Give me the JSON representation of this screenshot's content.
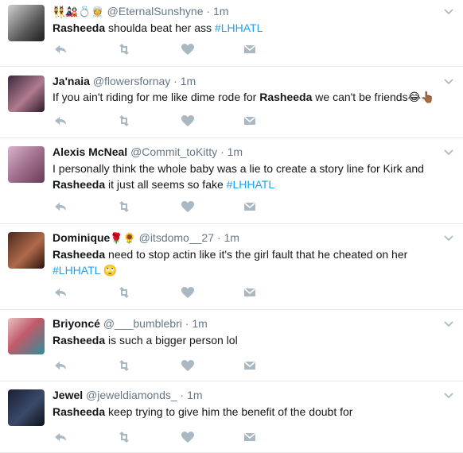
{
  "timeline": {
    "tweets": [
      {
        "name": "",
        "badges": "👯🎎💍👳",
        "handle": "@EternalSunshyne",
        "dot": "·",
        "time": "1m",
        "segments": [
          {
            "t": "Rasheeda",
            "k": "bold"
          },
          {
            "t": " shoulda beat her ass  ",
            "k": "plain"
          },
          {
            "t": "#LHHATL",
            "k": "tag"
          }
        ]
      },
      {
        "name": "Ja'naia",
        "badges": "",
        "handle": "@flowersfornay",
        "dot": "·",
        "time": "1m",
        "segments": [
          {
            "t": "If you ain't riding for me like dime rode for ",
            "k": "plain"
          },
          {
            "t": "Rasheeda",
            "k": "bold"
          },
          {
            "t": " we can't be friends",
            "k": "plain"
          },
          {
            "t": "😂👆🏾",
            "k": "plain"
          }
        ]
      },
      {
        "name": "Alexis McNeal",
        "badges": "",
        "handle": "@Commit_toKitty",
        "dot": "·",
        "time": "1m",
        "segments": [
          {
            "t": "I personally think the whole baby was a lie to create a story line for Kirk and ",
            "k": "plain"
          },
          {
            "t": "Rasheeda",
            "k": "bold"
          },
          {
            "t": " it just all seems so fake ",
            "k": "plain"
          },
          {
            "t": "#LHHATL",
            "k": "tag"
          }
        ]
      },
      {
        "name": "Dominique",
        "badges": "🌹🌻",
        "handle": "@itsdomo__27",
        "dot": "·",
        "time": "1m",
        "segments": [
          {
            "t": "Rasheeda",
            "k": "bold"
          },
          {
            "t": " need to stop actin like it's the girl fault that he cheated on her ",
            "k": "plain"
          },
          {
            "t": "#LHHATL",
            "k": "tag"
          },
          {
            "t": " 🙄",
            "k": "plain"
          }
        ]
      },
      {
        "name": "Briyoncé",
        "badges": "",
        "handle": "@___bumblebri",
        "dot": "·",
        "time": "1m",
        "segments": [
          {
            "t": "Rasheeda",
            "k": "bold"
          },
          {
            "t": " is such a bigger person lol",
            "k": "plain"
          }
        ]
      },
      {
        "name": "Jewel",
        "badges": "",
        "handle": "@jeweldiamonds_",
        "dot": "·",
        "time": "1m",
        "segments": [
          {
            "t": "Rasheeda",
            "k": "bold"
          },
          {
            "t": " keep trying to give him the benefit of the doubt for",
            "k": "plain"
          }
        ]
      }
    ]
  },
  "colors": {
    "text": "#14171a",
    "muted": "#657786",
    "hashtag": "#1da1f2",
    "action_icon": "#aab8c2",
    "divider": "#e6ecf0"
  },
  "icons": {
    "reply": "reply-icon",
    "retweet": "retweet-icon",
    "like": "heart-icon",
    "dm": "envelope-icon",
    "menu": "chevron-down-icon"
  }
}
